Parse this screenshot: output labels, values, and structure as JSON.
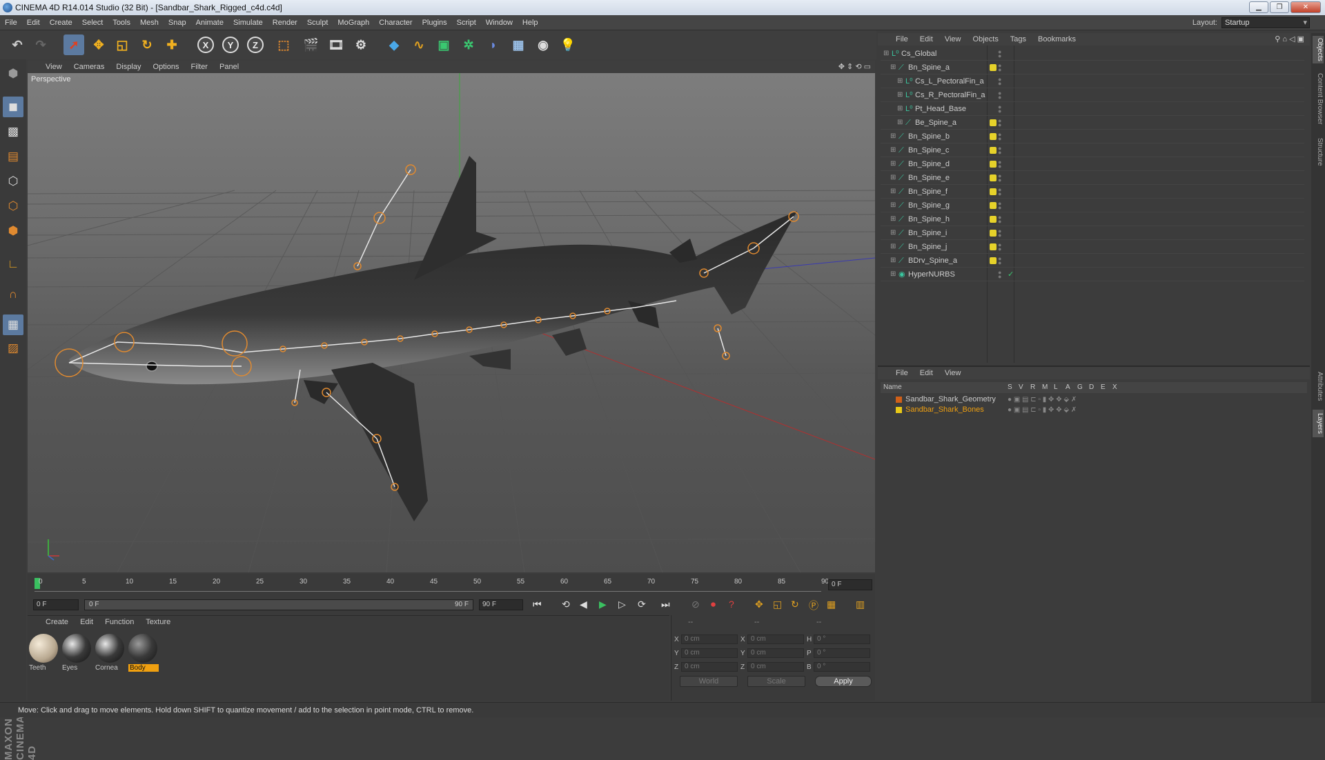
{
  "window": {
    "title": "CINEMA 4D R14.014 Studio (32 Bit) - [Sandbar_Shark_Rigged_c4d.c4d]",
    "min_label": "▁",
    "max_label": "❐",
    "close_label": "✕"
  },
  "menu": [
    "File",
    "Edit",
    "Create",
    "Select",
    "Tools",
    "Mesh",
    "Snap",
    "Animate",
    "Simulate",
    "Render",
    "Sculpt",
    "MoGraph",
    "Character",
    "Plugins",
    "Script",
    "Window",
    "Help"
  ],
  "layout": {
    "label": "Layout:",
    "value": "Startup"
  },
  "viewport": {
    "menu": [
      "View",
      "Cameras",
      "Display",
      "Options",
      "Filter",
      "Panel"
    ],
    "label": "Perspective"
  },
  "timeline": {
    "ticks": [
      "0",
      "5",
      "10",
      "15",
      "20",
      "25",
      "30",
      "35",
      "40",
      "45",
      "50",
      "55",
      "60",
      "65",
      "70",
      "75",
      "80",
      "85",
      "90"
    ],
    "current_frame": "0 F"
  },
  "transport": {
    "start": "0 F",
    "range_start": "0 F",
    "range_end": "90 F",
    "end": "90 F"
  },
  "materials": {
    "menu": [
      "Create",
      "Edit",
      "Function",
      "Texture"
    ],
    "items": [
      {
        "name": "Teeth",
        "selected": false
      },
      {
        "name": "Eyes",
        "selected": false
      },
      {
        "name": "Cornea",
        "selected": false
      },
      {
        "name": "Body",
        "selected": true
      }
    ]
  },
  "coords": {
    "headers": [
      "--",
      "--",
      "--"
    ],
    "rows": [
      {
        "a": "X",
        "av": "0 cm",
        "b": "X",
        "bv": "0 cm",
        "c": "H",
        "cv": "0 °"
      },
      {
        "a": "Y",
        "av": "0 cm",
        "b": "Y",
        "bv": "0 cm",
        "c": "P",
        "cv": "0 °"
      },
      {
        "a": "Z",
        "av": "0 cm",
        "b": "Z",
        "bv": "0 cm",
        "c": "B",
        "cv": "0 °"
      }
    ],
    "mode1": "World",
    "mode2": "Scale",
    "apply": "Apply"
  },
  "objects": {
    "menu": [
      "File",
      "Edit",
      "View",
      "Objects",
      "Tags",
      "Bookmarks"
    ],
    "rows": [
      {
        "name": "Cs_Global",
        "indent": 0,
        "tag": false
      },
      {
        "name": "Bn_Spine_a",
        "indent": 1,
        "tag": true
      },
      {
        "name": "Cs_L_PectoralFin_a",
        "indent": 2,
        "tag": false
      },
      {
        "name": "Cs_R_PectoralFin_a",
        "indent": 2,
        "tag": false
      },
      {
        "name": "Pt_Head_Base",
        "indent": 2,
        "tag": false
      },
      {
        "name": "Be_Spine_a",
        "indent": 2,
        "tag": true
      },
      {
        "name": "Bn_Spine_b",
        "indent": 1,
        "tag": true
      },
      {
        "name": "Bn_Spine_c",
        "indent": 1,
        "tag": true
      },
      {
        "name": "Bn_Spine_d",
        "indent": 1,
        "tag": true
      },
      {
        "name": "Bn_Spine_e",
        "indent": 1,
        "tag": true
      },
      {
        "name": "Bn_Spine_f",
        "indent": 1,
        "tag": true
      },
      {
        "name": "Bn_Spine_g",
        "indent": 1,
        "tag": true
      },
      {
        "name": "Bn_Spine_h",
        "indent": 1,
        "tag": true
      },
      {
        "name": "Bn_Spine_i",
        "indent": 1,
        "tag": true
      },
      {
        "name": "Bn_Spine_j",
        "indent": 1,
        "tag": true
      },
      {
        "name": "BDrv_Spine_a",
        "indent": 1,
        "tag": true
      },
      {
        "name": "HyperNURBS",
        "indent": 1,
        "tag": false
      }
    ]
  },
  "layers": {
    "menu": [
      "File",
      "Edit",
      "View"
    ],
    "columns": [
      "Name",
      "S",
      "V",
      "R",
      "M",
      "L",
      "A",
      "G",
      "D",
      "E",
      "X"
    ],
    "rows": [
      {
        "name": "Sandbar_Shark_Geometry",
        "color": "#d06018",
        "selected": false
      },
      {
        "name": "Sandbar_Shark_Bones",
        "color": "#e8c818",
        "selected": true
      }
    ]
  },
  "right_tabs": [
    "Objects",
    "Content Browser",
    "Structure",
    "Attributes",
    "Layers"
  ],
  "status": "Move: Click and drag to move elements. Hold down SHIFT to quantize movement / add to the selection in point mode, CTRL to remove.",
  "brand": "MAXON CINEMA 4D",
  "colors": {
    "accent": "#5c7aa0",
    "tag_yellow": "#e6d22a",
    "bone_orange": "#e08a30"
  }
}
